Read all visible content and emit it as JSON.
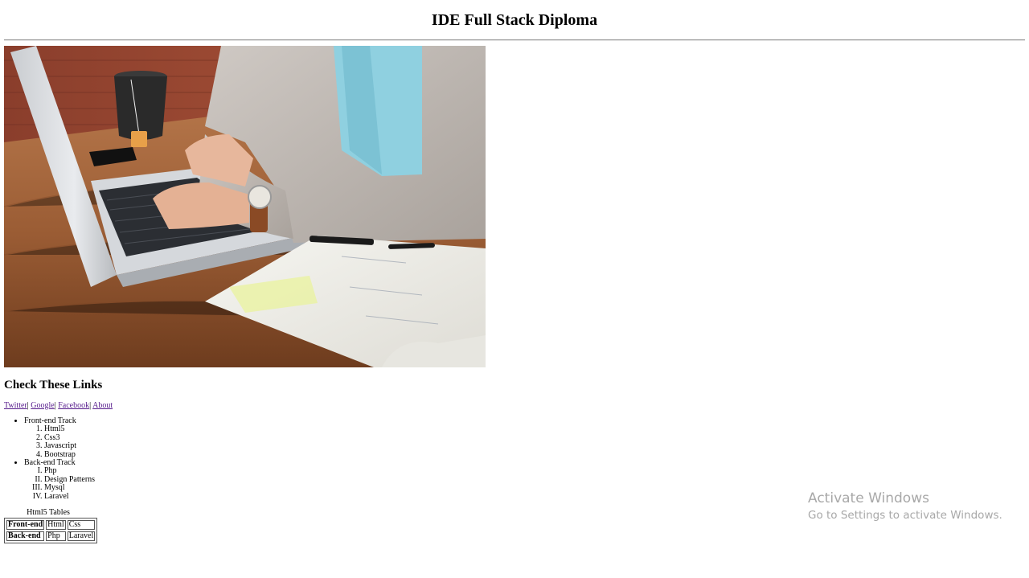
{
  "header": {
    "title": "IDE Full Stack Diploma"
  },
  "hero": {
    "alt": "Person typing on a laptop at a wooden desk with a tea cup and an open notebook",
    "icon": "hero-photo"
  },
  "links_section": {
    "heading": "Check These Links",
    "links": [
      {
        "label": "Twitter"
      },
      {
        "label": "Google"
      },
      {
        "label": "Facebook"
      },
      {
        "label": "About"
      }
    ],
    "separator": "|"
  },
  "tracks": [
    {
      "label": "Front-end Track",
      "items": [
        "Html5",
        "Css3",
        "Javascript",
        "Bootstrap"
      ]
    },
    {
      "label": "Back-end Track",
      "items": [
        "Php",
        "Design Patterns",
        "Mysql",
        "Laravel"
      ]
    }
  ],
  "table": {
    "caption": "Html5 Tables",
    "rows": [
      {
        "header": "Front-end",
        "cells": [
          "Html",
          "Css"
        ]
      },
      {
        "header": "Back-end",
        "cells": [
          "Php",
          "Laravel"
        ]
      }
    ]
  },
  "watermark": {
    "title": "Activate Windows",
    "subtitle": "Go to Settings to activate Windows."
  },
  "colors": {
    "link_visited": "#551a8b",
    "rule": "#9a9a9a",
    "watermark": "#a8a8a8"
  }
}
